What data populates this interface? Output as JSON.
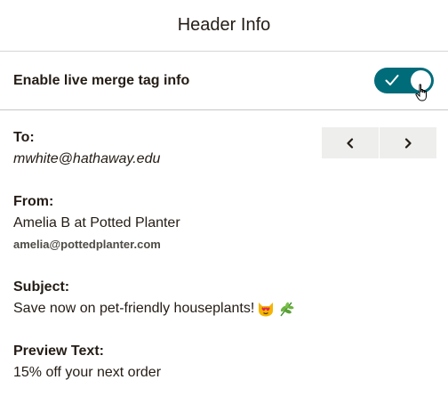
{
  "header": {
    "title": "Header Info"
  },
  "toggle": {
    "label": "Enable live merge tag info",
    "enabled": true,
    "color": "#006c7a"
  },
  "nav": {
    "prev_icon": "chevron-left-icon",
    "next_icon": "chevron-right-icon"
  },
  "fields": {
    "to": {
      "label": "To:",
      "value": "mwhite@hathaway.edu"
    },
    "from": {
      "label": "From:",
      "name": "Amelia B at Potted Planter",
      "email": "amelia@pottedplanter.com"
    },
    "subject": {
      "label": "Subject:",
      "value": "Save now on pet-friendly houseplants!",
      "emojis": [
        "heart-eyes-cat-emoji",
        "herb-emoji"
      ]
    },
    "preview": {
      "label": "Preview Text:",
      "value": "15% off your next order"
    }
  }
}
